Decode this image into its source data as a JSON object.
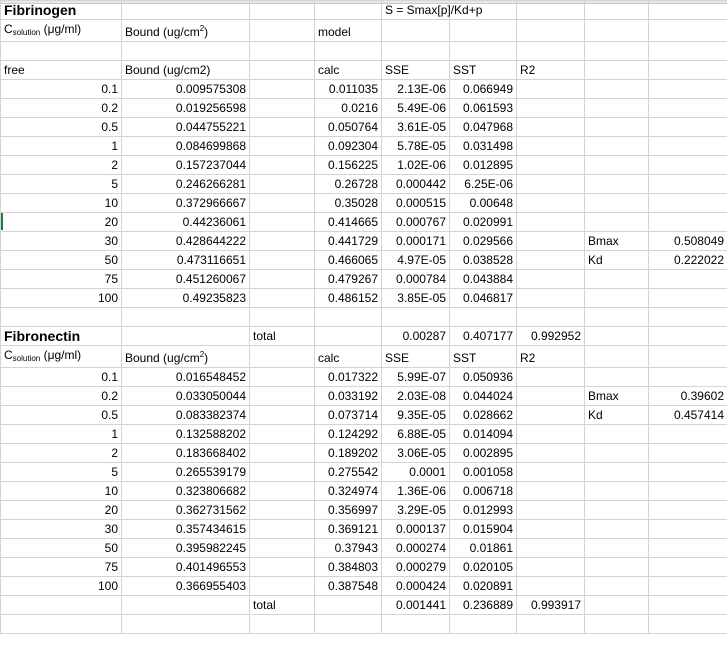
{
  "sheet": {
    "fib": {
      "title": "Fibrinogen",
      "formula": "S = Smax[p]/Kd+p",
      "c_sol_prefix": "C",
      "c_sol_sub": "solution",
      "c_sol_unit": " (μg/ml)",
      "bound_hdr": "Bound (ug/cm",
      "bound_sup": "2",
      "bound_close": ")",
      "model": "model",
      "free": "free",
      "bound2": "Bound (ug/cm2)",
      "calc": "calc",
      "sse": "SSE",
      "sst": "SST",
      "r2": "R2",
      "rows": [
        {
          "free": "0.1",
          "bound": "0.009575308",
          "calc": "0.011035",
          "sse": "2.13E-06",
          "sst": "0.066949"
        },
        {
          "free": "0.2",
          "bound": "0.019256598",
          "calc": "0.0216",
          "sse": "5.49E-06",
          "sst": "0.061593"
        },
        {
          "free": "0.5",
          "bound": "0.044755221",
          "calc": "0.050764",
          "sse": "3.61E-05",
          "sst": "0.047968"
        },
        {
          "free": "1",
          "bound": "0.084699868",
          "calc": "0.092304",
          "sse": "5.78E-05",
          "sst": "0.031498"
        },
        {
          "free": "2",
          "bound": "0.157237044",
          "calc": "0.156225",
          "sse": "1.02E-06",
          "sst": "0.012895"
        },
        {
          "free": "5",
          "bound": "0.246266281",
          "calc": "0.26728",
          "sse": "0.000442",
          "sst": "6.25E-06"
        },
        {
          "free": "10",
          "bound": "0.372966667",
          "calc": "0.35028",
          "sse": "0.000515",
          "sst": "0.00648"
        },
        {
          "free": "20",
          "bound": "0.44236061",
          "calc": "0.414665",
          "sse": "0.000767",
          "sst": "0.020991"
        },
        {
          "free": "30",
          "bound": "0.428644222",
          "calc": "0.441729",
          "sse": "0.000171",
          "sst": "0.029566",
          "k": "Bmax",
          "v": "0.508049"
        },
        {
          "free": "50",
          "bound": "0.473116651",
          "calc": "0.466065",
          "sse": "4.97E-05",
          "sst": "0.038528",
          "k": "Kd",
          "v": "0.222022"
        },
        {
          "free": "75",
          "bound": "0.451260067",
          "calc": "0.479267",
          "sse": "0.000784",
          "sst": "0.043884"
        },
        {
          "free": "100",
          "bound": "0.49235823",
          "calc": "0.486152",
          "sse": "3.85E-05",
          "sst": "0.046817"
        }
      ],
      "total_label": "total",
      "total_sse": "0.00287",
      "total_sst": "0.407177",
      "total_r2": "0.992952"
    },
    "fn": {
      "title": "Fibronectin",
      "c_sol_prefix": "C",
      "c_sol_sub": "solution",
      "c_sol_unit": " (μg/ml)",
      "bound_hdr": "Bound (ug/cm",
      "bound_sup": "2",
      "bound_close": ")",
      "calc": "calc",
      "sse": "SSE",
      "sst": "SST",
      "r2": "R2",
      "rows": [
        {
          "free": "0.1",
          "bound": "0.016548452",
          "calc": "0.017322",
          "sse": "5.99E-07",
          "sst": "0.050936"
        },
        {
          "free": "0.2",
          "bound": "0.033050044",
          "calc": "0.033192",
          "sse": "2.03E-08",
          "sst": "0.044024",
          "k": "Bmax",
          "v": "0.39602"
        },
        {
          "free": "0.5",
          "bound": "0.083382374",
          "calc": "0.073714",
          "sse": "9.35E-05",
          "sst": "0.028662",
          "k": "Kd",
          "v": "0.457414"
        },
        {
          "free": "1",
          "bound": "0.132588202",
          "calc": "0.124292",
          "sse": "6.88E-05",
          "sst": "0.014094"
        },
        {
          "free": "2",
          "bound": "0.183668402",
          "calc": "0.189202",
          "sse": "3.06E-05",
          "sst": "0.002895"
        },
        {
          "free": "5",
          "bound": "0.265539179",
          "calc": "0.275542",
          "sse": "0.0001",
          "sst": "0.001058"
        },
        {
          "free": "10",
          "bound": "0.323806682",
          "calc": "0.324974",
          "sse": "1.36E-06",
          "sst": "0.006718"
        },
        {
          "free": "20",
          "bound": "0.362731562",
          "calc": "0.356997",
          "sse": "3.29E-05",
          "sst": "0.012993"
        },
        {
          "free": "30",
          "bound": "0.357434615",
          "calc": "0.369121",
          "sse": "0.000137",
          "sst": "0.015904"
        },
        {
          "free": "50",
          "bound": "0.395982245",
          "calc": "0.37943",
          "sse": "0.000274",
          "sst": "0.01861"
        },
        {
          "free": "75",
          "bound": "0.401496553",
          "calc": "0.384803",
          "sse": "0.000279",
          "sst": "0.020105"
        },
        {
          "free": "100",
          "bound": "0.366955403",
          "calc": "0.387548",
          "sse": "0.000424",
          "sst": "0.020891"
        }
      ],
      "total_label": "total",
      "total_sse": "0.001441",
      "total_sst": "0.236889",
      "total_r2": "0.993917"
    }
  },
  "colors": {
    "grid": "#d4d4d4",
    "selection_marker": "#1f7a3f"
  }
}
